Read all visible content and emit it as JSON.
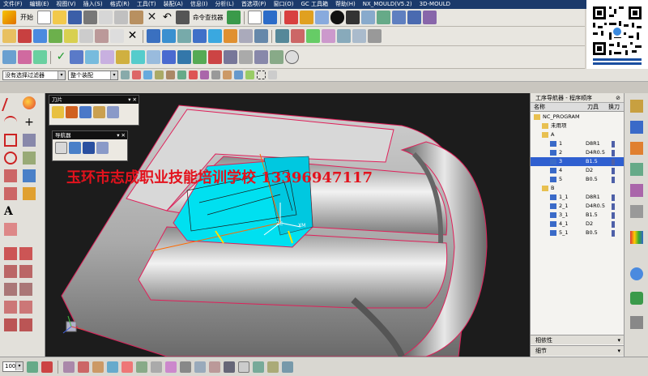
{
  "menubar": {
    "items": [
      "文件(F)",
      "编辑(E)",
      "视图(V)",
      "插入(S)",
      "格式(R)",
      "工具(T)",
      "装配(A)",
      "信息(I)",
      "分析(L)",
      "首选项(P)",
      "窗口(O)",
      "GC 工具箱",
      "帮助(H)",
      "NX_MOULD(V5.2)",
      "3D-MOULD"
    ]
  },
  "toolbar": {
    "start_label": "开始",
    "cmd_finder_label": "命令查找器"
  },
  "selection_bar": {
    "filter_value": "没有选择过滤器",
    "assembly_value": "整个装配"
  },
  "palette_tool": {
    "title": "刀片"
  },
  "palette_nav": {
    "title": "导航器"
  },
  "watermark": {
    "text": "玉环市志成职业技能培训学校 13396947117"
  },
  "viewport": {
    "axis_zc": "ZC",
    "axis_xm": "XM"
  },
  "navigator": {
    "title": "工序导航器 - 程序顺序",
    "col_name": "名称",
    "col_tool": "刀具",
    "col_change": "换刀",
    "rows": [
      {
        "name": "NC_PROGRAM",
        "tool": "",
        "level": 0,
        "type": "root",
        "selected": false
      },
      {
        "name": "未用项",
        "tool": "",
        "level": 1,
        "type": "folder",
        "selected": false
      },
      {
        "name": "A",
        "tool": "",
        "level": 1,
        "type": "group",
        "selected": false
      },
      {
        "name": "1",
        "tool": "D8R1",
        "level": 2,
        "type": "op",
        "selected": false
      },
      {
        "name": "2",
        "tool": "D4R0.5",
        "level": 2,
        "type": "op",
        "selected": false
      },
      {
        "name": "3",
        "tool": "B1.5",
        "level": 2,
        "type": "op",
        "selected": true
      },
      {
        "name": "4",
        "tool": "D2",
        "level": 2,
        "type": "op",
        "selected": false
      },
      {
        "name": "5",
        "tool": "B0.5",
        "level": 2,
        "type": "op",
        "selected": false
      },
      {
        "name": "B",
        "tool": "",
        "level": 1,
        "type": "group",
        "selected": false
      },
      {
        "name": "1_1",
        "tool": "D8R1",
        "level": 2,
        "type": "op",
        "selected": false
      },
      {
        "name": "2_1",
        "tool": "D4R0.5",
        "level": 2,
        "type": "op",
        "selected": false
      },
      {
        "name": "3_1",
        "tool": "B1.5",
        "level": 2,
        "type": "op",
        "selected": false
      },
      {
        "name": "4_1",
        "tool": "D2",
        "level": 2,
        "type": "op",
        "selected": false
      },
      {
        "name": "5_1",
        "tool": "B0.5",
        "level": 2,
        "type": "op",
        "selected": false
      }
    ],
    "dependency_label": "相依性",
    "details_label": "细节"
  },
  "statusbar": {
    "zoom_value": "100"
  },
  "colors": {
    "accent_cyan": "#00e0f0",
    "selection_blue": "#2f5fd0",
    "watermark_red": "#e3121c"
  }
}
